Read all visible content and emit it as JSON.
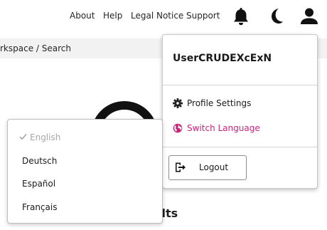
{
  "header": {
    "nav": [
      "About",
      "Help",
      "Legal Notice",
      "Support"
    ],
    "icons": [
      "bell-icon",
      "moon-icon",
      "user-icon"
    ]
  },
  "breadcrumb": "rkspace / Search",
  "content": {
    "results_title": "ılts"
  },
  "user_menu": {
    "username": "UserCRUDEXcExN",
    "profile_settings": "Profile Settings",
    "switch_language": "Switch Language",
    "logout": "Logout"
  },
  "language_menu": {
    "items": [
      "English",
      "Deutsch",
      "Español",
      "Français"
    ],
    "selected": "English"
  },
  "colors": {
    "accent": "#c8267a",
    "disabled_text": "#a6a6a6"
  }
}
